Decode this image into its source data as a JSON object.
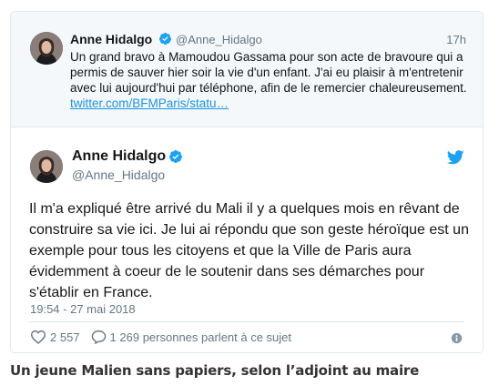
{
  "quoted_tweet": {
    "name": "Anne Hidalgo",
    "handle": "@Anne_Hidalgo",
    "time": "17h",
    "text": "Un grand bravo à Mamoudou Gassama pour son acte de bravoure qui a permis de sauver hier soir la vie d'un enfant. J'ai eu plaisir à m'entretenir avec lui aujourd'hui par téléphone, afin de le remercier chaleureusement. ",
    "link": "twitter.com/BFMParis/statu…"
  },
  "main_tweet": {
    "name": "Anne Hidalgo",
    "handle": "@Anne_Hidalgo",
    "text": "Il m'a expliqué être arrivé du Mali il y a quelques mois en rêvant de construire sa vie ici. Je lui ai répondu que son geste héroïque est un exemple pour tous les citoyens et que la Ville de Paris aura évidemment à coeur de le soutenir dans ses démarches pour s'établir en France.",
    "date": "19:54 - 27 mai 2018",
    "likes": "2 557",
    "replies": "1 269 personnes parlent à ce sujet"
  },
  "caption": "Un jeune Malien sans papiers, selon l’adjoint au maire",
  "colors": {
    "verified": "#1da1f2",
    "link": "#1b95e0",
    "muted": "#657786",
    "border": "#e1e8ed",
    "quoted_bg": "#f5f8fa"
  },
  "icons": [
    "verified-badge-icon",
    "twitter-bird-icon",
    "heart-icon",
    "reply-icon",
    "info-icon"
  ]
}
